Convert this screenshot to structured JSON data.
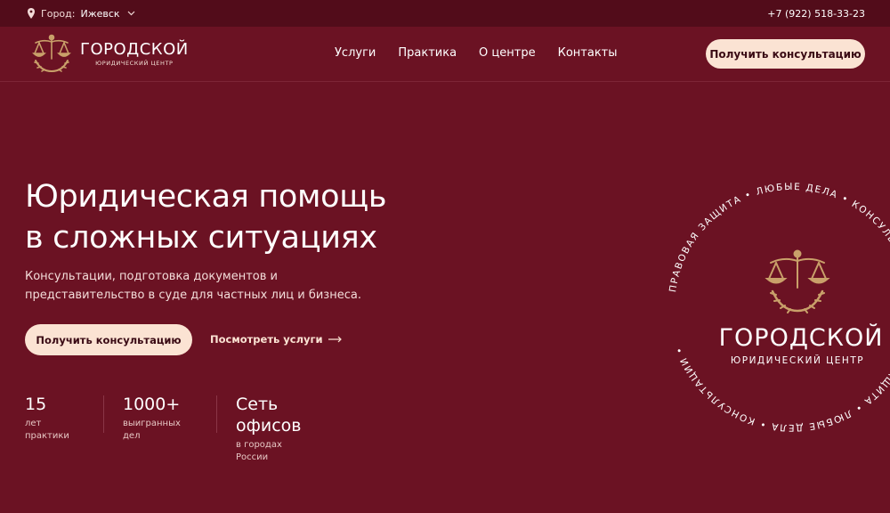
{
  "topbar": {
    "city_label": "Город:",
    "city_value": "Ижевск",
    "phone": "+7 (922) 518-33-23"
  },
  "header": {
    "logo_name": "ГОРОДСКОЙ",
    "logo_sub": "ЮРИДИЧЕСКИЙ ЦЕНТР",
    "nav": [
      {
        "label": "Услуги"
      },
      {
        "label": "Практика"
      },
      {
        "label": "О центре"
      },
      {
        "label": "Контакты"
      }
    ],
    "cta_label": "Получить консультацию"
  },
  "hero": {
    "title_line1": "Юридическая помощь",
    "title_line2": "в сложных ситуациях",
    "desc_line1": "Консультации, подготовка документов и",
    "desc_line2": "представительство в суде для частных лиц и бизнеса.",
    "cta_label": "Получить консультацию",
    "services_link": "Посмотреть услуги"
  },
  "stats": [
    {
      "num": "15",
      "cap": "лет практики"
    },
    {
      "num": "1000+",
      "cap": "выигранных дел"
    },
    {
      "num": "Сеть офисов",
      "cap": "в городах России"
    }
  ],
  "badge": {
    "ring_text": "ПРАВОВАЯ ЗАЩИТА • ЛЮБЫЕ ДЕЛА • КОНСУЛЬТАЦИИ • ПРАВОВАЯ ЗАЩИТА • ЛЮБЫЕ ДЕЛА • КОНСУЛЬТАЦИИ •",
    "name": "ГОРОДСКОЙ",
    "sub": "ЮРИДИЧЕСКИЙ ЦЕНТР"
  },
  "icons": {
    "pin": "location-pin-icon",
    "chevron": "chevron-down-icon",
    "arrow": "arrow-right-icon",
    "emblem": "scales-laurel-emblem"
  },
  "colors": {
    "background": "#6b1223",
    "topbar": "#520c1a",
    "accent": "#fbe3d3",
    "gold": "#c9a06a"
  }
}
